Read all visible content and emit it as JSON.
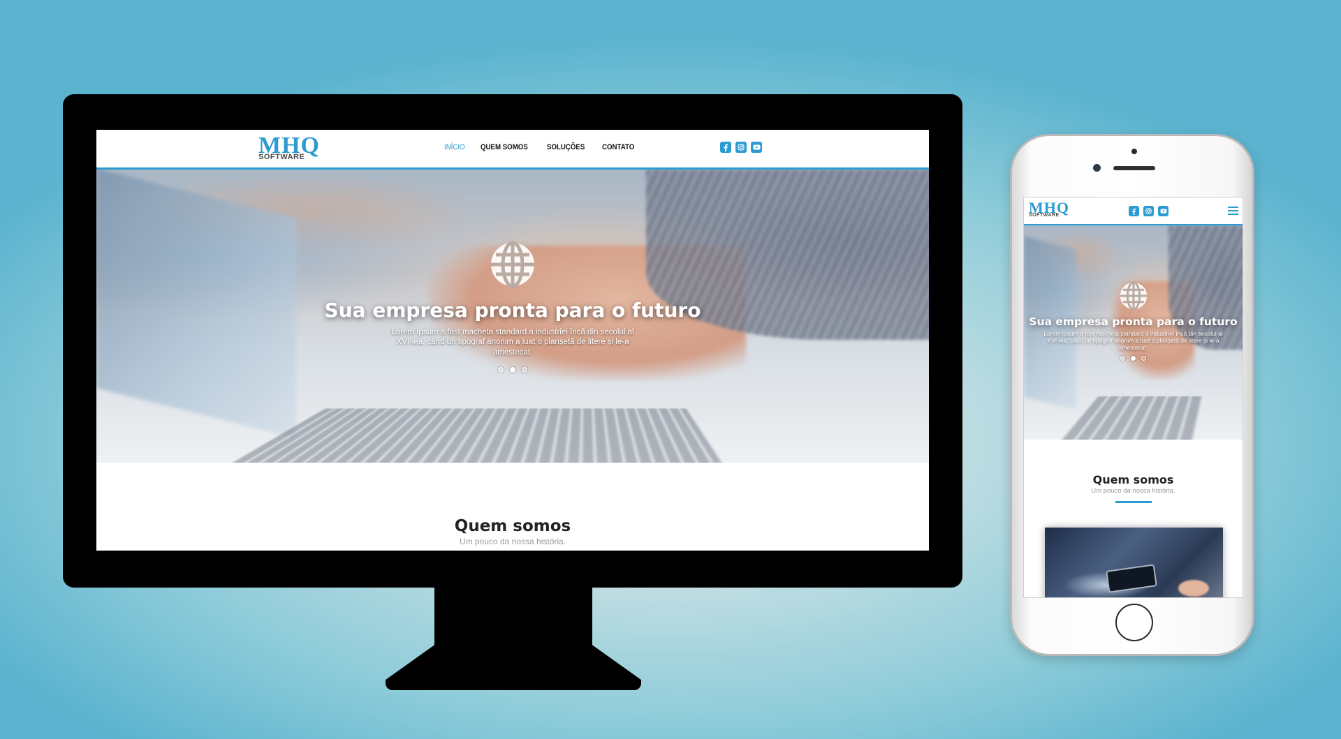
{
  "colors": {
    "accent": "#2b9bd1",
    "text_dark": "#222222",
    "text_muted": "#9a9a9a",
    "device_frame": "#000000"
  },
  "logo": {
    "main": "MHQ",
    "sub": "SOFTWARE"
  },
  "nav": {
    "items": [
      {
        "label": "INÍCIO",
        "active": true
      },
      {
        "label": "QUEM SOMOS",
        "active": false
      },
      {
        "label": "SOLUÇÕES",
        "active": false
      },
      {
        "label": "CONTATO",
        "active": false
      }
    ]
  },
  "social": [
    {
      "name": "facebook-icon",
      "glyph": "f"
    },
    {
      "name": "instagram-icon",
      "glyph": "◎"
    },
    {
      "name": "youtube-icon",
      "glyph": "▶"
    }
  ],
  "hero": {
    "icon": "globe-icon",
    "title": "Sua empresa pronta para o futuro",
    "text": "Lorem Ipsum a fost macheta standard a industriei încă din secolul al XVI-lea, când un tipograf anonim a luat o planșetă de litere și le-a amestecat.",
    "slides": 3,
    "active_slide": 2
  },
  "about": {
    "title": "Quem somos",
    "subtitle": "Um pouco da nossa história."
  }
}
